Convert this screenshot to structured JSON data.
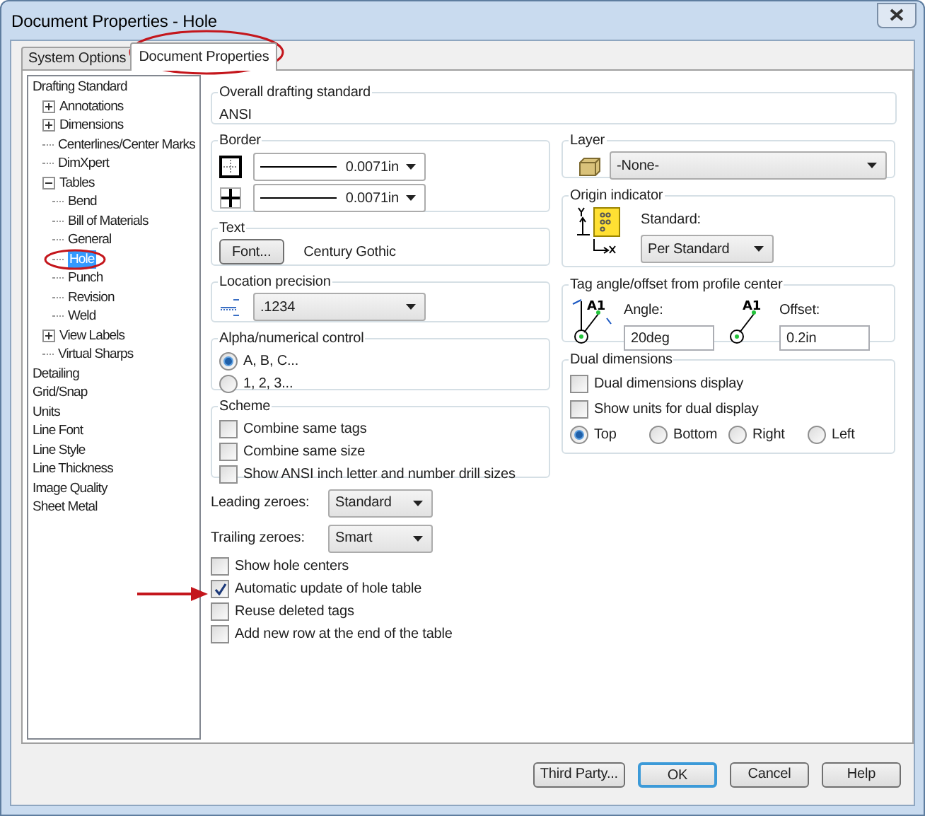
{
  "window": {
    "title": "Document Properties - Hole"
  },
  "tabs": [
    {
      "label": "System Options",
      "selected": false
    },
    {
      "label": "Document Properties",
      "selected": true
    }
  ],
  "tree": [
    {
      "label": "Drafting Standard",
      "selected": false,
      "children": [
        {
          "label": "Annotations",
          "selected": false,
          "expanded": false
        },
        {
          "label": "Dimensions",
          "selected": false,
          "expanded": false
        },
        {
          "label": "Centerlines/Center Marks",
          "selected": false
        },
        {
          "label": "DimXpert",
          "selected": false
        },
        {
          "label": "Tables",
          "selected": false,
          "expanded": true,
          "children": [
            {
              "label": "Bend",
              "selected": false
            },
            {
              "label": "Bill of Materials",
              "selected": false
            },
            {
              "label": "General",
              "selected": false
            },
            {
              "label": "Hole",
              "selected": true
            },
            {
              "label": "Punch",
              "selected": false
            },
            {
              "label": "Revision",
              "selected": false
            },
            {
              "label": "Weld",
              "selected": false
            }
          ]
        },
        {
          "label": "View Labels",
          "selected": false,
          "expanded": false
        },
        {
          "label": "Virtual Sharps",
          "selected": false
        }
      ]
    },
    {
      "label": "Detailing",
      "selected": false
    },
    {
      "label": "Grid/Snap",
      "selected": false
    },
    {
      "label": "Units",
      "selected": false
    },
    {
      "label": "Line Font",
      "selected": false
    },
    {
      "label": "Line Style",
      "selected": false
    },
    {
      "label": "Line Thickness",
      "selected": false
    },
    {
      "label": "Image Quality",
      "selected": false
    },
    {
      "label": "Sheet Metal",
      "selected": false
    }
  ],
  "overall_drafting_standard": {
    "title": "Overall drafting standard",
    "value": "ANSI"
  },
  "border": {
    "title": "Border",
    "dropdowns": [
      {
        "value": "0.0071in"
      },
      {
        "value": "0.0071in"
      }
    ]
  },
  "text": {
    "title": "Text",
    "button": "Font...",
    "font": "Century Gothic"
  },
  "location_precision": {
    "title": "Location precision",
    "value": ".1234"
  },
  "alpha_numerical_control": {
    "title": "Alpha/numerical control",
    "options": [
      {
        "label": "A, B, C...",
        "selected": true
      },
      {
        "label": "1, 2, 3...",
        "selected": false
      }
    ]
  },
  "scheme": {
    "title": "Scheme",
    "options": [
      {
        "label": "Combine same tags",
        "checked": false
      },
      {
        "label": "Combine same size",
        "checked": false
      },
      {
        "label": "Show ANSI inch letter and number drill sizes",
        "checked": false
      }
    ]
  },
  "leading_zeroes": {
    "label": "Leading zeroes:",
    "value": "Standard"
  },
  "trailing_zeroes": {
    "label": "Trailing zeroes:",
    "value": "Smart"
  },
  "options": [
    {
      "label": "Show hole centers",
      "checked": false
    },
    {
      "label": "Automatic update of hole table",
      "checked": true
    },
    {
      "label": "Reuse deleted tags",
      "checked": false
    },
    {
      "label": "Add new row at the end of the table",
      "checked": false
    }
  ],
  "layer": {
    "title": "Layer",
    "value": "-None-"
  },
  "origin_indicator": {
    "title": "Origin indicator",
    "label": "Standard:",
    "value": "Per Standard"
  },
  "tag_angle_offset": {
    "title": "Tag angle/offset from profile center",
    "angle_icon_label": "A1",
    "angle_label": "Angle:",
    "angle": "20deg",
    "offset_icon_label": "A1",
    "offset_label": "Offset:",
    "offset": "0.2in"
  },
  "dual_dimensions": {
    "title": "Dual dimensions",
    "checkboxes": [
      {
        "label": "Dual dimensions display",
        "checked": false
      },
      {
        "label": "Show units for dual display",
        "checked": false
      }
    ],
    "position": [
      {
        "label": "Top",
        "selected": true
      },
      {
        "label": "Bottom",
        "selected": false
      },
      {
        "label": "Right",
        "selected": false
      },
      {
        "label": "Left",
        "selected": false
      }
    ]
  },
  "buttons": [
    {
      "label": "Third Party...",
      "default": false
    },
    {
      "label": "OK",
      "default": true
    },
    {
      "label": "Cancel",
      "default": false
    },
    {
      "label": "Help",
      "default": false
    }
  ]
}
